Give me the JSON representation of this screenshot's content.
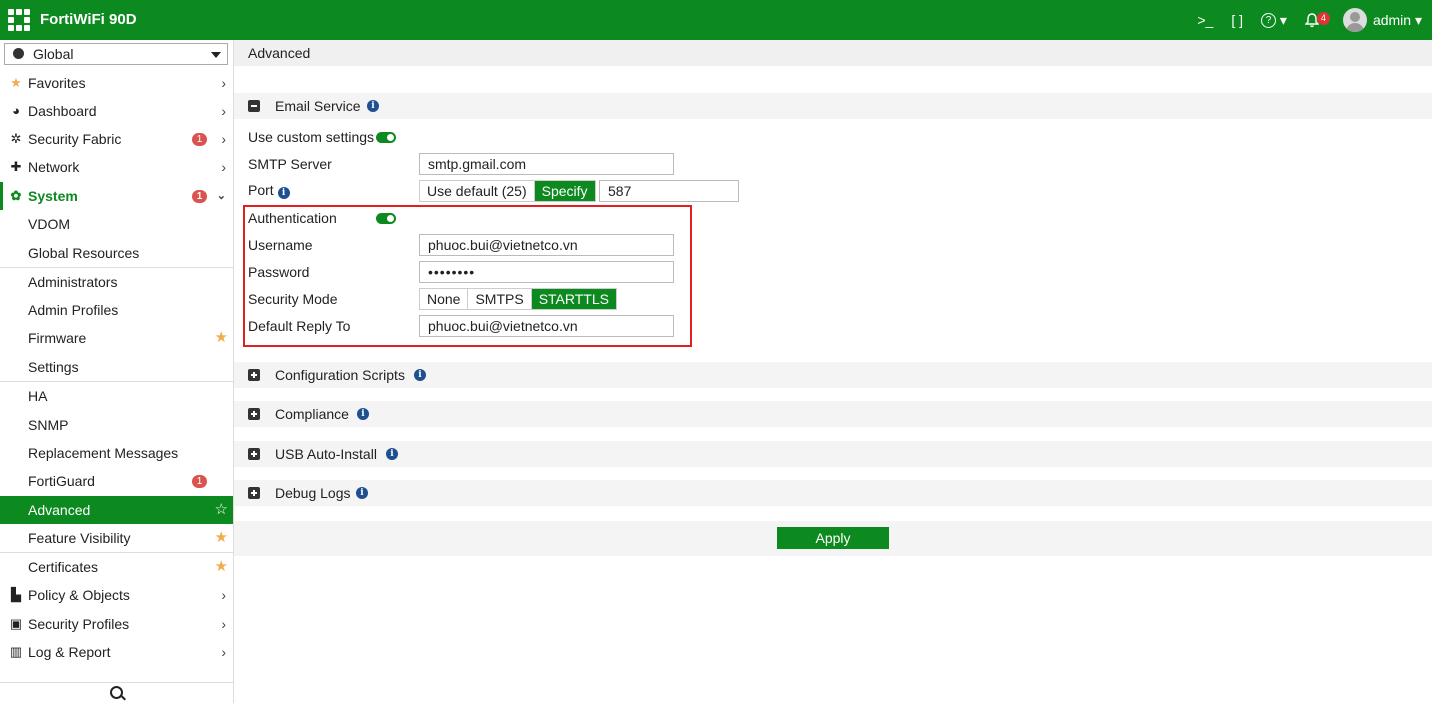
{
  "header": {
    "brand": "FortiWiFi 90D",
    "cli_icon": ">_",
    "fullscreen_icon": "[ ]",
    "help_icon": "?",
    "notification_count": "4",
    "user": "admin"
  },
  "sidebar": {
    "vdom": "Global",
    "search_icon": "search-icon",
    "items": [
      {
        "label": "Favorites",
        "icon": "star-icon"
      },
      {
        "label": "Dashboard",
        "icon": "dashboard-icon"
      },
      {
        "label": "Security Fabric",
        "icon": "fabric-icon",
        "badge": "1"
      },
      {
        "label": "Network",
        "icon": "network-icon"
      },
      {
        "label": "System",
        "icon": "gear-icon",
        "badge": "1"
      },
      {
        "label": "VDOM"
      },
      {
        "label": "Global Resources"
      },
      {
        "label": "Administrators"
      },
      {
        "label": "Admin Profiles"
      },
      {
        "label": "Firmware"
      },
      {
        "label": "Settings"
      },
      {
        "label": "HA"
      },
      {
        "label": "SNMP"
      },
      {
        "label": "Replacement Messages"
      },
      {
        "label": "FortiGuard",
        "badge": "1"
      },
      {
        "label": "Advanced"
      },
      {
        "label": "Feature Visibility"
      },
      {
        "label": "Certificates"
      },
      {
        "label": "Policy & Objects",
        "icon": "policy-icon"
      },
      {
        "label": "Security Profiles",
        "icon": "lock-icon"
      },
      {
        "label": "Log & Report",
        "icon": "chart-icon"
      }
    ]
  },
  "main": {
    "breadcrumb": "Advanced",
    "email": {
      "title": "Email Service",
      "use_custom": "Use custom settings",
      "smtp_label": "SMTP Server",
      "smtp_value": "smtp.gmail.com",
      "port_label": "Port",
      "port_default": "Use default (25)",
      "port_specify": "Specify",
      "port_value": "587",
      "auth_label": "Authentication",
      "username_label": "Username",
      "username_value": "phuoc.bui@vietnetco.vn",
      "password_label": "Password",
      "password_value": "••••••••",
      "security_label": "Security Mode",
      "security_options": [
        "None",
        "SMTPS",
        "STARTTLS"
      ],
      "security_selected": "STARTTLS",
      "reply_label": "Default Reply To",
      "reply_value": "phuoc.bui@vietnetco.vn"
    },
    "sections": [
      "Configuration Scripts",
      "Compliance",
      "USB Auto-Install",
      "Debug Logs"
    ],
    "apply_label": "Apply"
  },
  "colors": {
    "brand_green": "#0d8a1f",
    "badge_red": "#d9534f",
    "highlight_red": "#e02020",
    "star": "#f0ad4e"
  }
}
